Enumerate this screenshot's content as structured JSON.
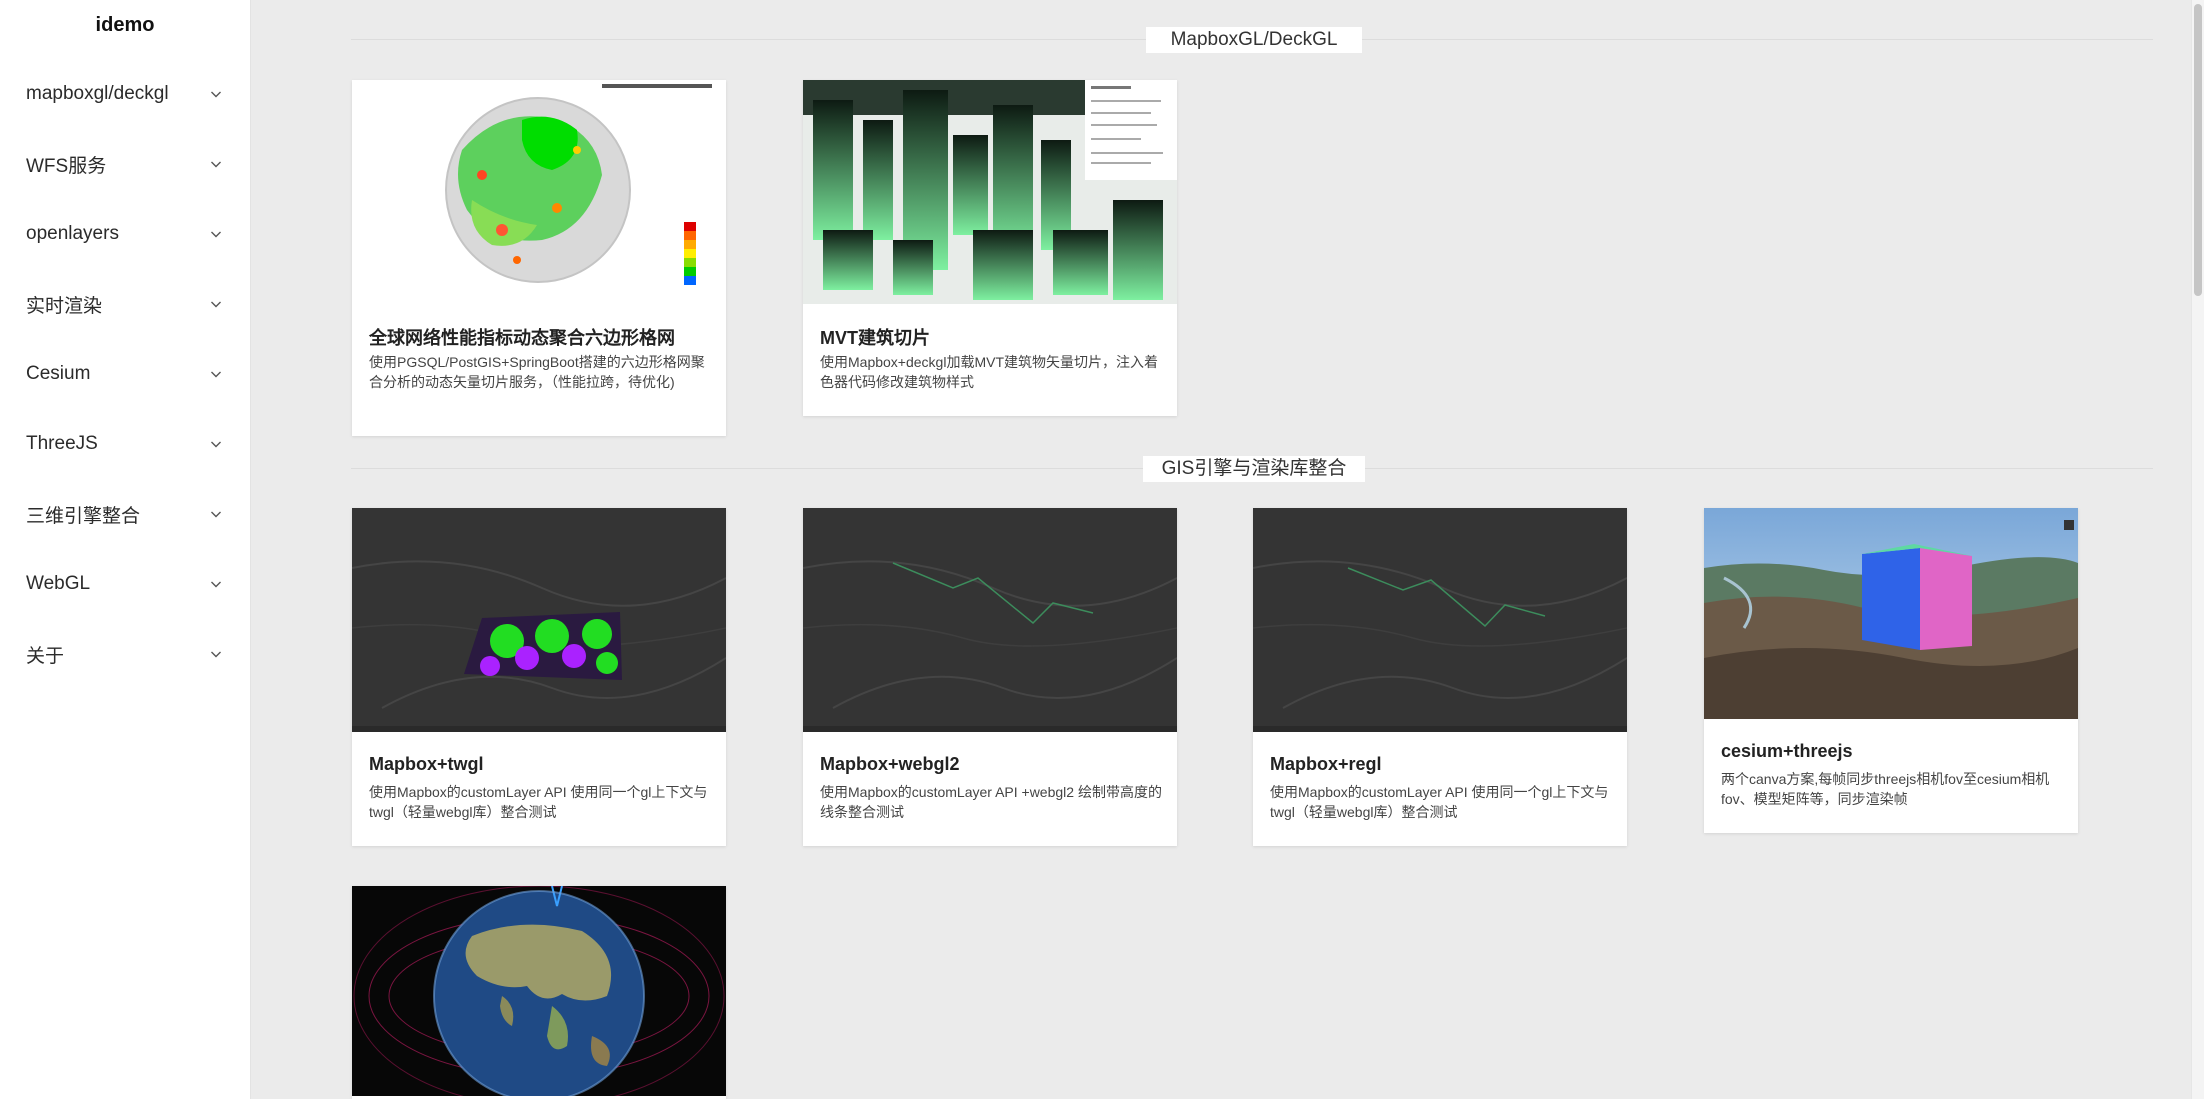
{
  "app": {
    "brand": "idemo"
  },
  "sidebar": {
    "items": [
      {
        "label": "mapboxgl/deckgl",
        "icon": "chevron-down-icon"
      },
      {
        "label": "WFS服务",
        "icon": "chevron-down-icon"
      },
      {
        "label": "openlayers",
        "icon": "chevron-down-icon"
      },
      {
        "label": "实时渲染",
        "icon": "chevron-down-icon"
      },
      {
        "label": "Cesium",
        "icon": "chevron-down-icon"
      },
      {
        "label": "ThreeJS",
        "icon": "chevron-down-icon"
      },
      {
        "label": "三维引擎整合",
        "icon": "chevron-down-icon"
      },
      {
        "label": "WebGL",
        "icon": "chevron-down-icon"
      },
      {
        "label": "关于",
        "icon": "chevron-down-icon"
      }
    ]
  },
  "sections": [
    {
      "title": "MapboxGL/DeckGL",
      "cards": [
        {
          "title": "全球网络性能指标动态聚合六边形格网",
          "desc": "使用PGSQL/PostGIS+SpringBoot搭建的六边形格网聚合分析的动态矢量切片服务，（性能拉跨，待优化)",
          "thumbnail": "globe-hexagon-grid-thumbnail"
        },
        {
          "title": "MVT建筑切片",
          "desc": "使用Mapbox+deckgl加载MVT建筑物矢量切片，注入着色器代码修改建筑物样式",
          "thumbnail": "3d-buildings-thumbnail"
        }
      ]
    },
    {
      "title": "GIS引擎与渲染库整合",
      "cards": [
        {
          "title": "Mapbox+twgl",
          "desc": "使用Mapbox的customLayer API 使用同一个gl上下文与twgl（轻量webgl库）整合测试",
          "thumbnail": "dark-map-twgl-thumbnail"
        },
        {
          "title": "Mapbox+webgl2",
          "desc": "使用Mapbox的customLayer API +webgl2 绘制带高度的线条整合测试",
          "thumbnail": "dark-map-webgl2-thumbnail"
        },
        {
          "title": "Mapbox+regl",
          "desc": "使用Mapbox的customLayer API 使用同一个gl上下文与twgl（轻量webgl库）整合测试",
          "thumbnail": "dark-map-regl-thumbnail"
        },
        {
          "title": "cesium+threejs",
          "desc": "两个canva方案,每帧同步threejs相机fov至cesium相机fov、模型矩阵等，同步渲染帧",
          "thumbnail": "terrain-cube-thumbnail"
        },
        {
          "title": "",
          "desc": "",
          "thumbnail": "earth-globe-thumbnail"
        }
      ]
    }
  ],
  "colors": {
    "page_background": "#ebebeb",
    "sidebar_background": "#ffffff",
    "card_background": "#ffffff",
    "text_primary": "#222222",
    "text_secondary": "#444444"
  }
}
